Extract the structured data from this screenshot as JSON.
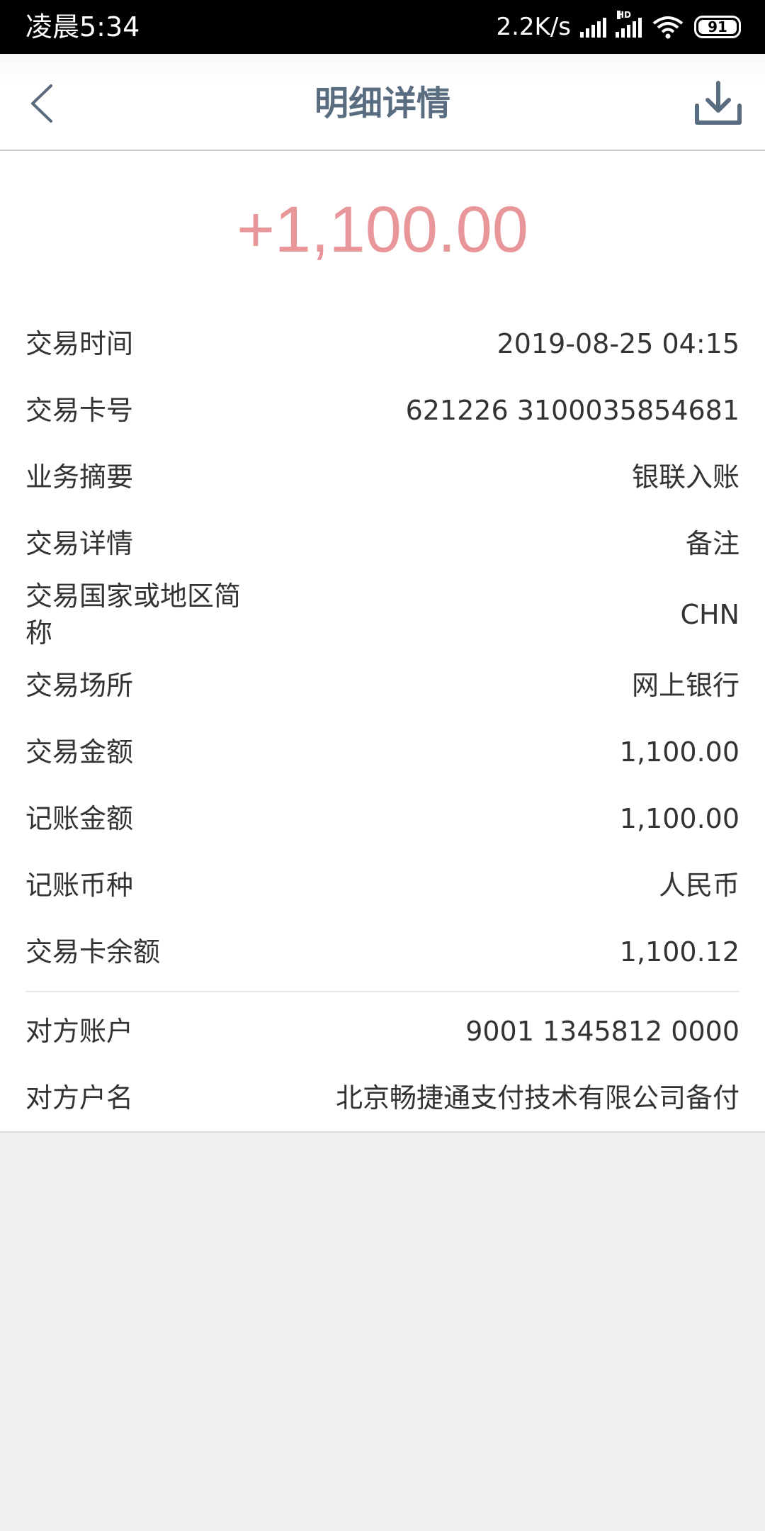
{
  "status_bar": {
    "time": "凌晨5:34",
    "network_speed": "2.2K/s",
    "hd_label": "HD",
    "battery": "91"
  },
  "header": {
    "title": "明细详情"
  },
  "amount": "+1,100.00",
  "colors": {
    "amount": "#e9969b",
    "title": "#5a6d80",
    "background": "#efefef"
  },
  "details": [
    {
      "label": "交易时间",
      "value": "2019-08-25 04:15"
    },
    {
      "label": "交易卡号",
      "value": "621226 3100035854681"
    },
    {
      "label": "业务摘要",
      "value": "银联入账"
    },
    {
      "label": "交易详情",
      "value": "备注"
    },
    {
      "label": "交易国家或地区简称",
      "value": "CHN"
    },
    {
      "label": "交易场所",
      "value": "网上银行"
    },
    {
      "label": "交易金额",
      "value": "1,100.00"
    },
    {
      "label": "记账金额",
      "value": "1,100.00"
    },
    {
      "label": "记账币种",
      "value": "人民币"
    },
    {
      "label": "交易卡余额",
      "value": "1,100.12"
    }
  ],
  "counterparty": [
    {
      "label": "对方账户",
      "value": "9001 1345812 0000"
    },
    {
      "label": "对方户名",
      "value": "北京畅捷通支付技术有限公司备付"
    }
  ]
}
